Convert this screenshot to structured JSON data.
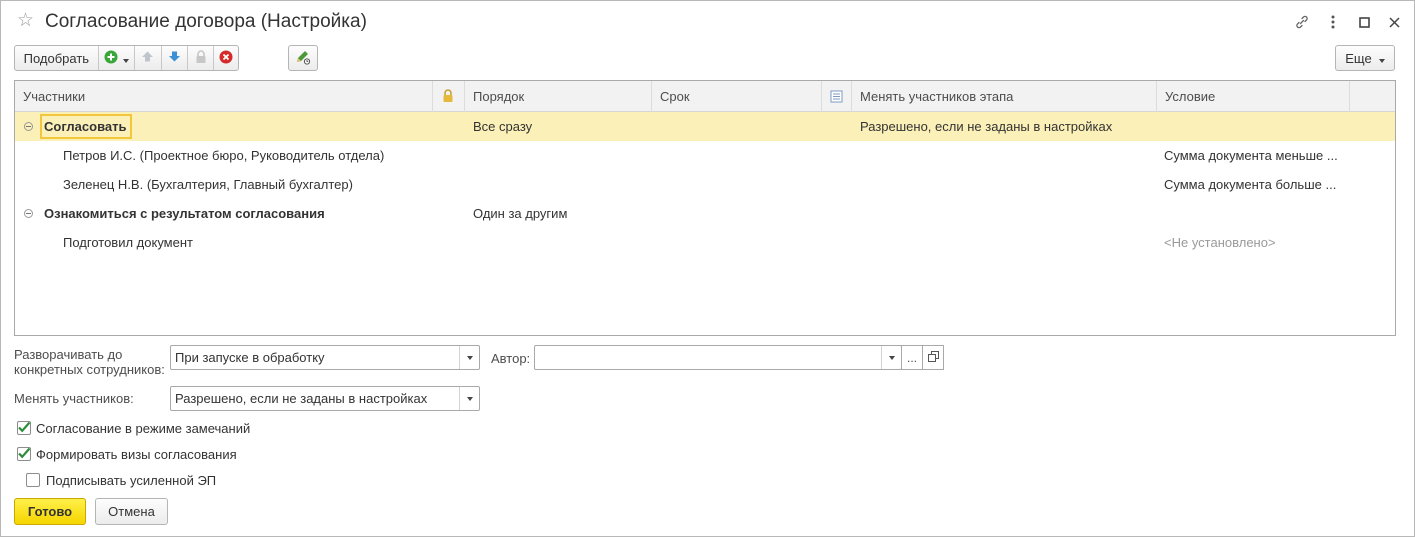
{
  "window": {
    "title": "Согласование договора (Настройка)"
  },
  "toolbar": {
    "pick_label": "Подобрать",
    "more_label": "Еще"
  },
  "grid": {
    "columns": [
      "Участники",
      "Порядок",
      "Срок",
      "Менять участников этапа",
      "Условие"
    ],
    "rows": [
      {
        "name": "Согласовать",
        "order": "Все сразу",
        "term": "",
        "change": "Разрешено, если не заданы в настройках",
        "condition": ""
      },
      {
        "name": "Петров И.С. (Проектное бюро, Руководитель отдела)",
        "order": "",
        "term": "",
        "change": "",
        "condition": "Сумма документа меньше ..."
      },
      {
        "name": "Зеленец Н.В. (Бухгалтерия, Главный бухгалтер)",
        "order": "",
        "term": "",
        "change": "",
        "condition": "Сумма документа больше ..."
      },
      {
        "name": "Ознакомиться с результатом согласования",
        "order": "Один за другим",
        "term": "",
        "change": "",
        "condition": ""
      },
      {
        "name": "Подготовил документ",
        "order": "",
        "term": "",
        "change": "",
        "condition": "<Не установлено>"
      }
    ]
  },
  "form": {
    "expand_label_line1": "Разворачивать до",
    "expand_label_line2": "конкретных сотрудников:",
    "expand_value": "При запуске в обработку",
    "author_label": "Автор:",
    "author_value": "",
    "author_more": "...",
    "change_label": "Менять участников:",
    "change_value": "Разрешено, если не заданы в настройках",
    "checkboxes": [
      {
        "label": "Согласование в режиме замечаний",
        "checked": true
      },
      {
        "label": "Формировать визы согласования",
        "checked": true
      },
      {
        "label": "Подписывать усиленной ЭП",
        "checked": false
      }
    ]
  },
  "footer": {
    "ok_label": "Готово",
    "cancel_label": "Отмена"
  },
  "colors": {
    "selected_row": "#fbf0b8",
    "primary_button": "#f5d500",
    "check": "#2e8b3a"
  }
}
